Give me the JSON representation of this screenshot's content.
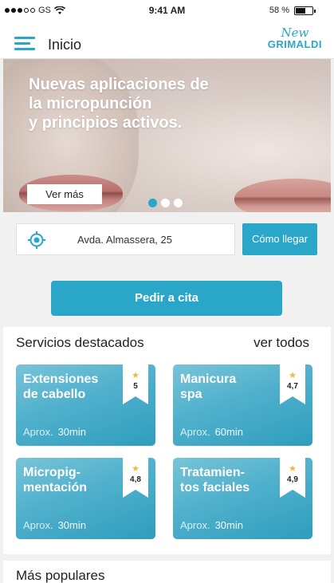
{
  "status_bar": {
    "carrier": "GS",
    "time": "9:41 AM",
    "battery": "58 %",
    "battery_level": 0.58
  },
  "header": {
    "title": "Inicio",
    "brand_script": "New",
    "brand_name": "GRIMALDI"
  },
  "hero": {
    "title": "Nuevas aplicaciones de\nla micropunción\ny principios activos.",
    "button": "Ver más",
    "slides": 3,
    "active_slide": 1
  },
  "location": {
    "address": "Avda. Almassera, 25",
    "directions_label": "Cómo llegar"
  },
  "cta": {
    "label": "Pedir a cita"
  },
  "services": {
    "title": "Servicios destacados",
    "see_all": "ver todos",
    "approx_label": "Aprox.",
    "items": [
      {
        "title": "Extensiones\nde cabello",
        "rating": "5",
        "duration": "30min"
      },
      {
        "title": "Manicura\nspa",
        "rating": "4,7",
        "duration": "60min"
      },
      {
        "title": "Micropig-\nmentación",
        "rating": "4,8",
        "duration": "30min"
      },
      {
        "title": "Tratamien-\ntos faciales",
        "rating": "4,9",
        "duration": "30min"
      }
    ]
  },
  "popular": {
    "title": "Más populares"
  },
  "colors": {
    "accent": "#2aa7c8",
    "star": "#f1b83a",
    "background": "#f1f1f1"
  },
  "icons": {
    "menu": "hamburger-icon",
    "location": "target-icon",
    "rating": "star-icon"
  }
}
